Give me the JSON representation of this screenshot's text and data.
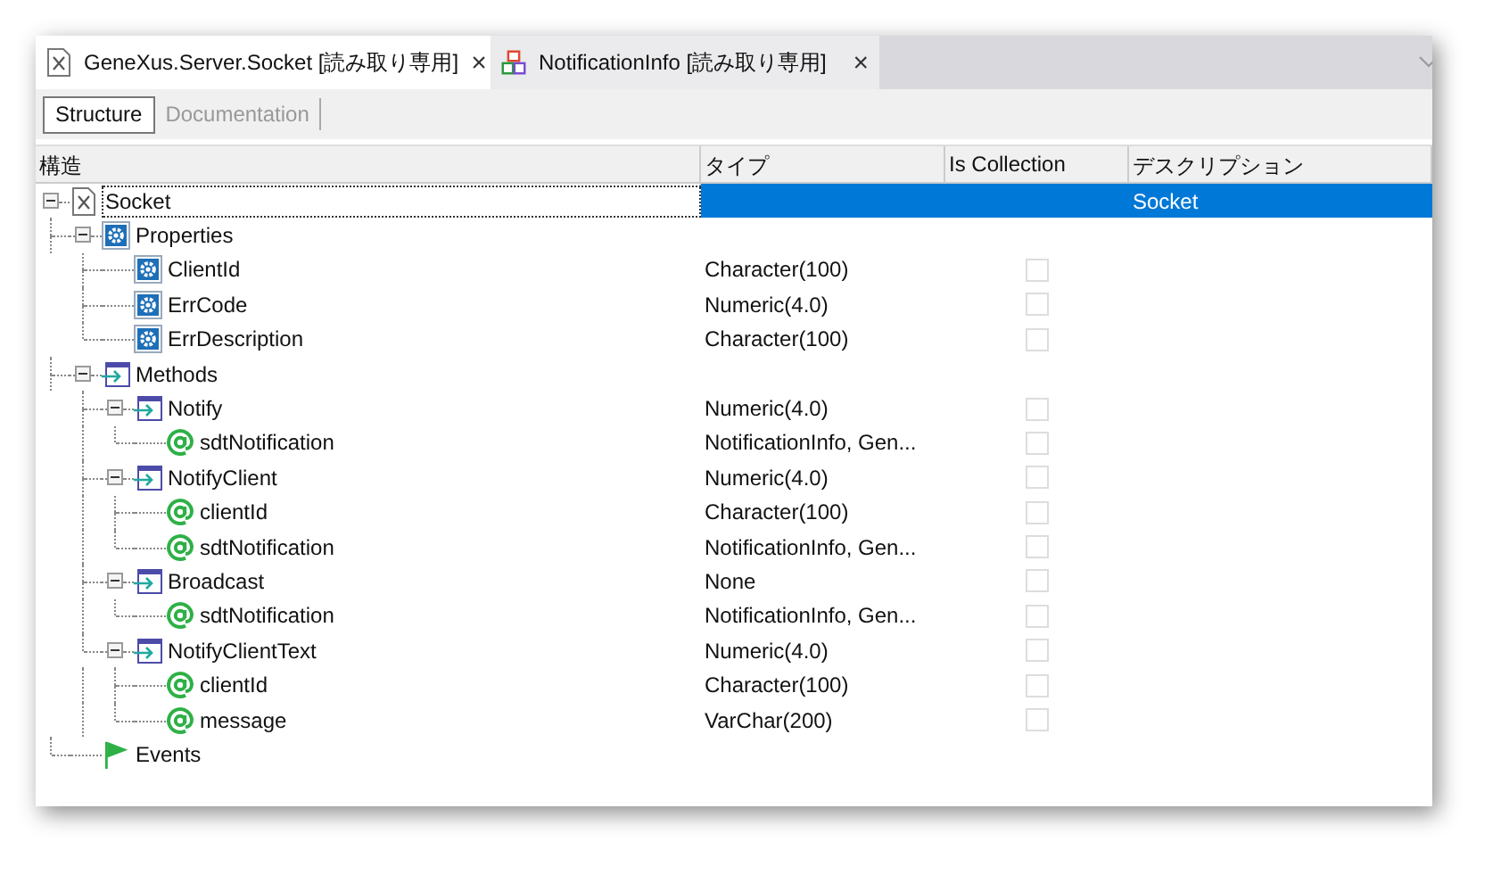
{
  "tabs": [
    {
      "label": "GeneXus.Server.Socket [読み取り専用]",
      "kind": "object",
      "selected": true,
      "close": "×"
    },
    {
      "label": "NotificationInfo [読み取り専用]",
      "kind": "sdt",
      "selected": false,
      "close": "×"
    }
  ],
  "views": [
    {
      "label": "Structure",
      "selected": true
    },
    {
      "label": "Documentation",
      "selected": false
    }
  ],
  "columns": [
    "構造",
    "タイプ",
    "Is Collection",
    "デスクリプション"
  ],
  "tree": [
    {
      "kind": "object",
      "name": "Socket",
      "selected": true,
      "expanded": true,
      "description": "Socket",
      "children": [
        {
          "kind": "properties",
          "name": "Properties",
          "selected": false,
          "expanded": true,
          "children": [
            {
              "kind": "property",
              "name": "ClientId",
              "selected": false,
              "type": "Character(100)",
              "is_collection": false
            },
            {
              "kind": "property",
              "name": "ErrCode",
              "selected": false,
              "type": "Numeric(4.0)",
              "is_collection": false
            },
            {
              "kind": "property",
              "name": "ErrDescription",
              "selected": false,
              "type": "Character(100)",
              "is_collection": false
            }
          ]
        },
        {
          "kind": "method",
          "name": "Methods",
          "selected": false,
          "expanded": true,
          "children": [
            {
              "kind": "method",
              "name": "Notify",
              "selected": false,
              "expanded": true,
              "type": "Numeric(4.0)",
              "is_collection": false,
              "children": [
                {
                  "kind": "parameter",
                  "name": "sdtNotification",
                  "selected": false,
                  "type": "NotificationInfo, Gen...",
                  "is_collection": false
                }
              ]
            },
            {
              "kind": "method",
              "name": "NotifyClient",
              "selected": false,
              "expanded": true,
              "type": "Numeric(4.0)",
              "is_collection": false,
              "children": [
                {
                  "kind": "parameter",
                  "name": "clientId",
                  "selected": false,
                  "type": "Character(100)",
                  "is_collection": false
                },
                {
                  "kind": "parameter",
                  "name": "sdtNotification",
                  "selected": false,
                  "type": "NotificationInfo, Gen...",
                  "is_collection": false
                }
              ]
            },
            {
              "kind": "method",
              "name": "Broadcast",
              "selected": false,
              "expanded": true,
              "type": "None",
              "is_collection": false,
              "children": [
                {
                  "kind": "parameter",
                  "name": "sdtNotification",
                  "selected": false,
                  "type": "NotificationInfo, Gen...",
                  "is_collection": false
                }
              ]
            },
            {
              "kind": "method",
              "name": "NotifyClientText",
              "selected": false,
              "expanded": true,
              "type": "Numeric(4.0)",
              "is_collection": false,
              "children": [
                {
                  "kind": "parameter",
                  "name": "clientId",
                  "selected": false,
                  "type": "Character(100)",
                  "is_collection": false
                },
                {
                  "kind": "parameter",
                  "name": "message",
                  "selected": false,
                  "type": "VarChar(200)",
                  "is_collection": false
                }
              ]
            }
          ]
        },
        {
          "kind": "events",
          "name": "Events",
          "selected": false
        }
      ]
    }
  ]
}
